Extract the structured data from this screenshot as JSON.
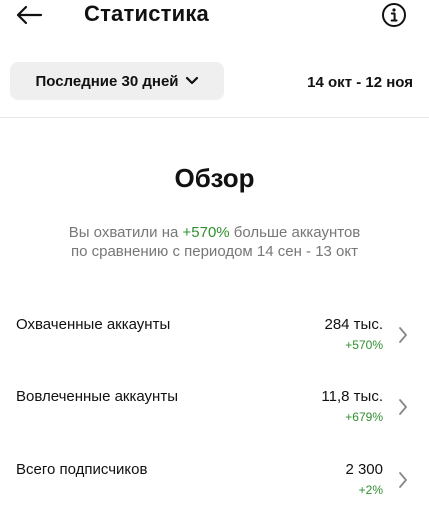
{
  "header": {
    "title": "Статистика",
    "back_icon": "arrow-left-icon",
    "info_icon": "info-circle-icon"
  },
  "filters": {
    "range_label": "Последние 30 дней",
    "date_range": "14 окт - 12 ноя"
  },
  "overview": {
    "title": "Обзор",
    "summary_prefix": "Вы охватили на ",
    "summary_highlight": "+570%",
    "summary_suffix": " больше аккаунтов",
    "summary_line2": "по сравнению с периодом 14 сен - 13 окт"
  },
  "metrics": [
    {
      "label": "Охваченные аккаунты",
      "value": "284 тыс.",
      "delta": "+570%"
    },
    {
      "label": "Вовлеченные аккаунты",
      "value": "11,8 тыс.",
      "delta": "+679%"
    },
    {
      "label": "Всего подписчиков",
      "value": "2 300",
      "delta": "+2%"
    }
  ],
  "colors": {
    "positive": "#2f8f2f",
    "muted_text": "#777777",
    "button_bg": "#efefef",
    "text": "#111111"
  }
}
